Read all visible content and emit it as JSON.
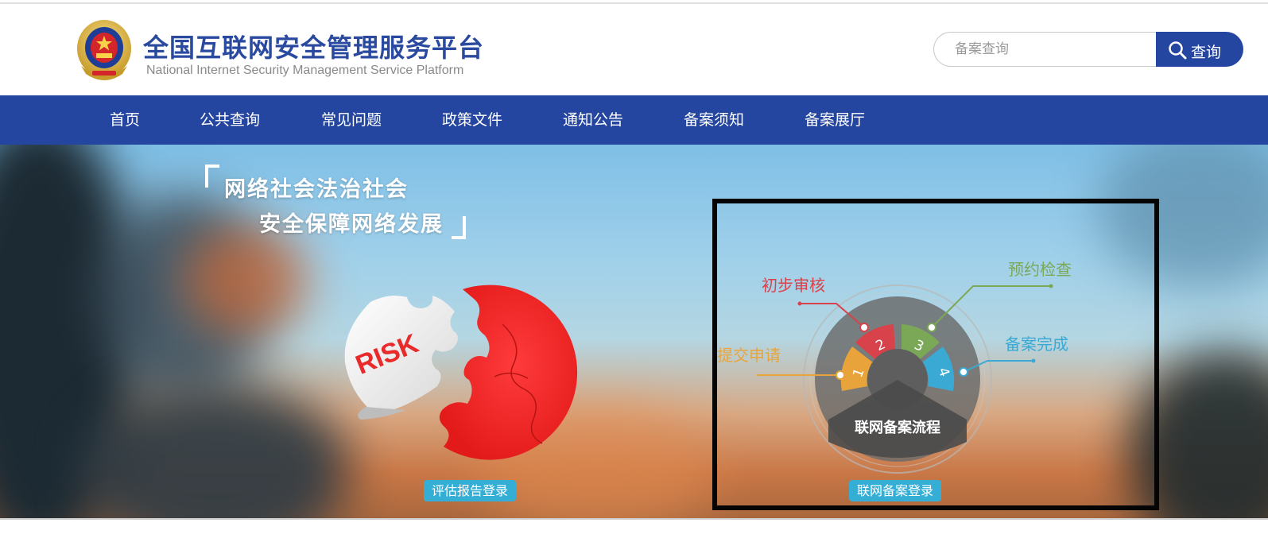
{
  "header": {
    "title": "全国互联网安全管理服务平台",
    "subtitle": "National Internet Security Management Service Platform"
  },
  "search": {
    "placeholder": "备案查询",
    "button_label": "查询"
  },
  "nav": {
    "items": [
      {
        "label": "首页"
      },
      {
        "label": "公共查询"
      },
      {
        "label": "常见问题"
      },
      {
        "label": "政策文件"
      },
      {
        "label": "通知公告"
      },
      {
        "label": "备案须知"
      },
      {
        "label": "备案展厅"
      }
    ]
  },
  "hero": {
    "slogan_line1": "网络社会法治社会",
    "slogan_line2": "安全保障网络发展",
    "risk_text": "RISK",
    "risk_button": "评估报告登录",
    "flow": {
      "center_label": "联网备案流程",
      "steps": [
        {
          "number": "1",
          "label": "提交申请",
          "color": "#e8a43a"
        },
        {
          "number": "2",
          "label": "初步审核",
          "color": "#d8424a"
        },
        {
          "number": "3",
          "label": "预约检查",
          "color": "#7ba857"
        },
        {
          "number": "4",
          "label": "备案完成",
          "color": "#3aa9d4"
        }
      ]
    },
    "filing_button": "联网备案登录"
  },
  "colors": {
    "brand_blue": "#2446a0",
    "pill_blue": "#35aed6",
    "puzzle_red": "#f22a2a"
  }
}
